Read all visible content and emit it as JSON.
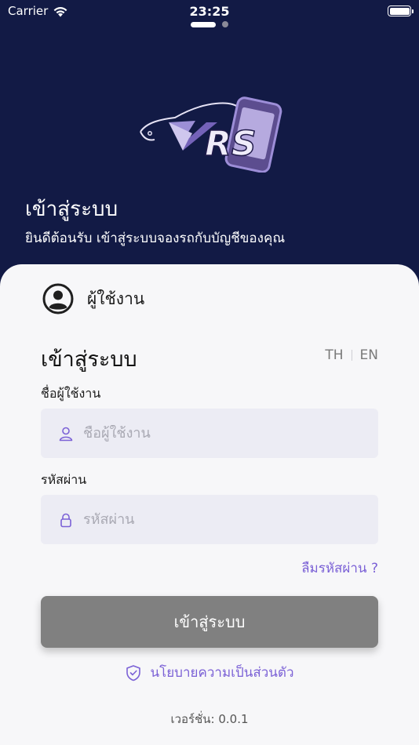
{
  "status_bar": {
    "carrier": "Carrier",
    "time": "23:25",
    "battery_level": 1.0
  },
  "pager": {
    "pages": 2,
    "active": 0
  },
  "logo": {
    "text": "VRS"
  },
  "hero": {
    "title": "เข้าสู่ระบบ",
    "subtitle": "ยินดีต้อนรับ เข้าสู่ระบบจองรถกับบัญชีของคุณ"
  },
  "account_type": {
    "label": "ผู้ใช้งาน"
  },
  "form": {
    "title": "เข้าสู่ระบบ",
    "lang_th": "TH",
    "lang_en": "EN",
    "username_label": "ชื่อผู้ใช้งาน",
    "username_placeholder": "ชื่อผู้ใช้งาน",
    "username_value": "",
    "password_label": "รหัสผ่าน",
    "password_placeholder": "รหัสผ่าน",
    "password_value": "",
    "forgot_label": "ลืมรหัสผ่าน ?",
    "submit_label": "เข้าสู่ระบบ"
  },
  "footer": {
    "policy_label": "นโยบายความเป็นส่วนตัว",
    "version": "เวอร์ชั่น: 0.0.1"
  },
  "colors": {
    "header_bg": "#121a45",
    "accent": "#7b61d6",
    "button_bg": "#808080",
    "card_bg": "#f7f7f9",
    "input_bg": "#ececf4"
  },
  "icons": {
    "wifi": "wifi-icon",
    "battery": "battery-icon",
    "user": "user-circle-icon",
    "person": "person-icon",
    "lock": "lock-icon",
    "shield": "shield-check-icon"
  }
}
